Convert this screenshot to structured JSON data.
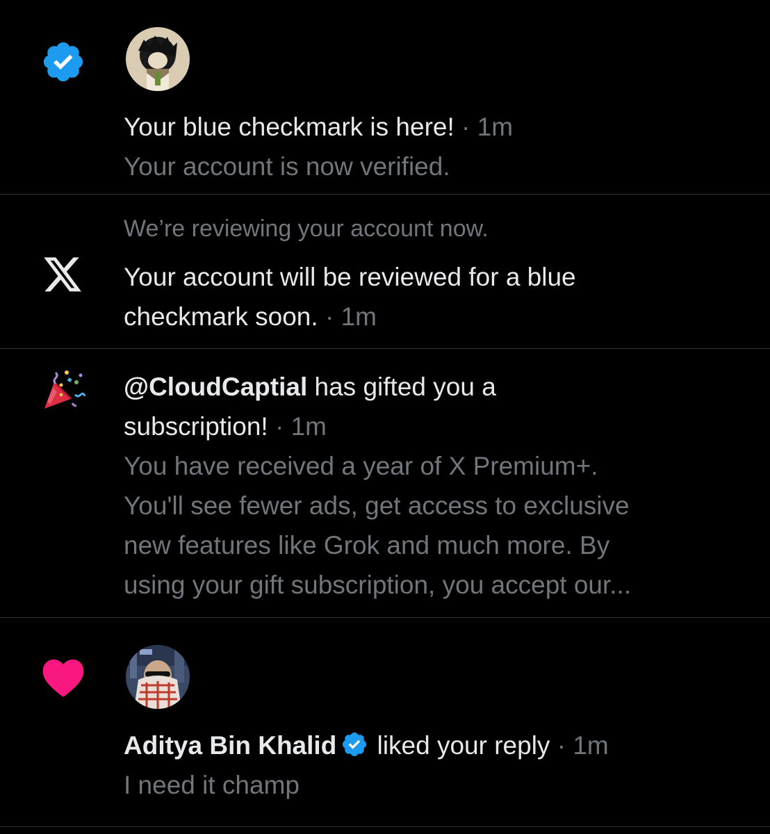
{
  "notifications": [
    {
      "type": "verified",
      "icon": "verified-badge-icon",
      "avatar": "user-avatar-anime",
      "title": "Your blue checkmark is here!",
      "time": "1m",
      "body": "Your account is now verified."
    },
    {
      "type": "system",
      "icon": "x-logo-icon",
      "header": "We’re reviewing your account now.",
      "title_line1": "Your account will be reviewed for a blue",
      "title_line2": "checkmark soon.",
      "time": "1m"
    },
    {
      "type": "gift",
      "icon": "party-popper-icon",
      "handle": "@CloudCaptial",
      "title_rest_line1": "has gifted you a",
      "title_line2": "subscription!",
      "time": "1m",
      "body_lines": [
        "You have received a year of X Premium+.",
        "You'll see fewer ads, get access to exclusive",
        "new features like Grok and much more. By",
        "using your gift subscription, you accept our..."
      ]
    },
    {
      "type": "like",
      "icon": "heart-icon",
      "avatar": "user-avatar-keffiyeh",
      "name": "Aditya Bin Khalid",
      "action": "liked your reply",
      "time": "1m",
      "body": "I need it champ"
    }
  ],
  "separator": "·",
  "colors": {
    "background": "#000000",
    "text_primary": "#e7e9ea",
    "text_secondary": "#71767b",
    "divider": "#2f3336",
    "verified_blue": "#1d9bf0",
    "like_pink": "#f91880"
  }
}
